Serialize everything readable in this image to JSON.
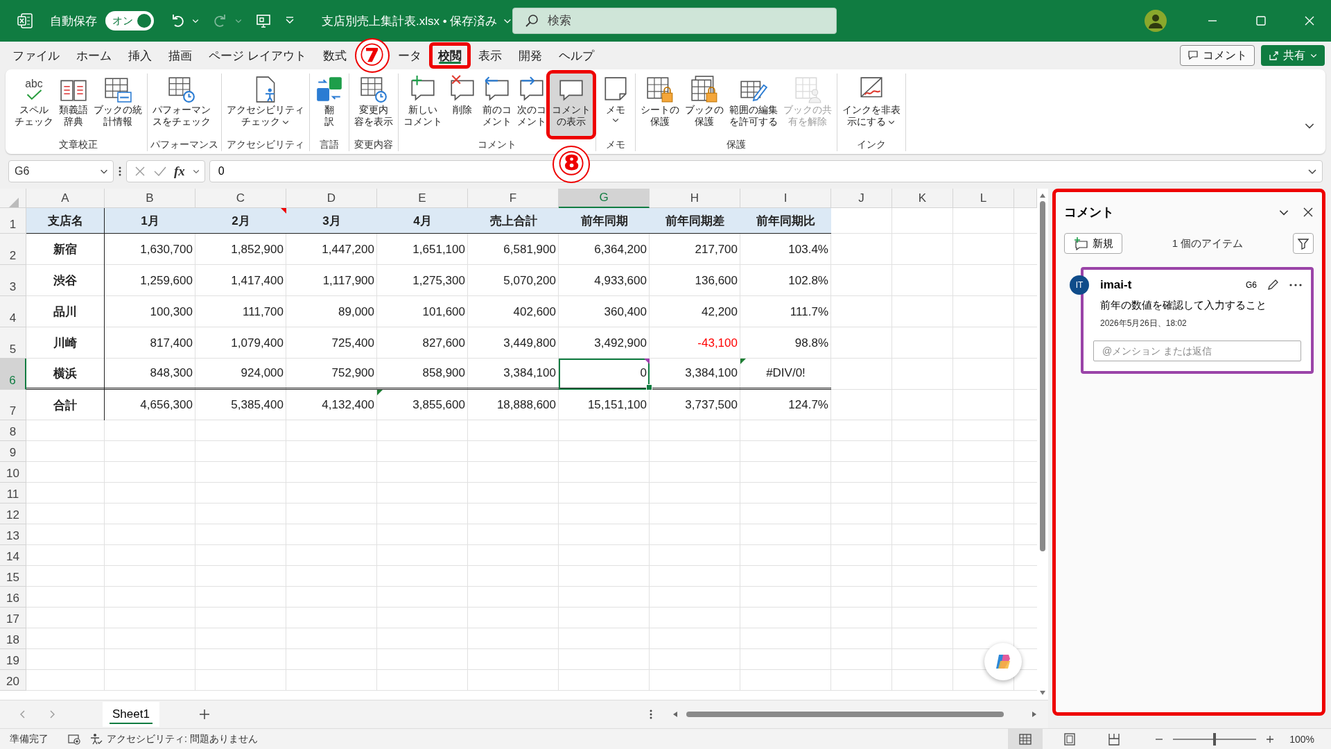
{
  "titlebar": {
    "autosave": {
      "label": "自動保存",
      "state_text": "オン",
      "on": true
    },
    "document_title": "支店別売上集計表.xlsx • 保存済み",
    "search_placeholder": "検索"
  },
  "menu_tabs": [
    {
      "label": "ファイル",
      "selected": false,
      "highlighted": false
    },
    {
      "label": "ホーム",
      "selected": false,
      "highlighted": false
    },
    {
      "label": "挿入",
      "selected": false,
      "highlighted": false
    },
    {
      "label": "描画",
      "selected": false,
      "highlighted": false
    },
    {
      "label": "ページ レイアウト",
      "selected": false,
      "highlighted": false
    },
    {
      "label": "数式",
      "selected": false,
      "highlighted": false
    },
    {
      "label": "ータ",
      "selected": false,
      "highlighted": false,
      "callout": "⑦"
    },
    {
      "label": "校閲",
      "selected": true,
      "highlighted": true
    },
    {
      "label": "表示",
      "selected": false,
      "highlighted": false
    },
    {
      "label": "開発",
      "selected": false,
      "highlighted": false
    },
    {
      "label": "ヘルプ",
      "selected": false,
      "highlighted": false
    }
  ],
  "header_buttons": {
    "comments": "コメント",
    "share": "共有"
  },
  "ribbon_groups": [
    {
      "label": "文章校正",
      "buttons": [
        {
          "lines": [
            "スペル",
            "チェック"
          ],
          "icon_text": "abc",
          "dropdown": false,
          "disabled": false,
          "on": false,
          "highlighted": false
        },
        {
          "lines": [
            "類義語",
            "辞典"
          ],
          "dropdown": false,
          "disabled": false,
          "on": false,
          "highlighted": false
        },
        {
          "lines": [
            "ブックの統",
            "計情報"
          ],
          "dropdown": false,
          "disabled": false,
          "on": false,
          "highlighted": false
        }
      ]
    },
    {
      "label": "パフォーマンス",
      "buttons": [
        {
          "lines": [
            "パフォーマン",
            "スをチェック"
          ],
          "dropdown": false,
          "disabled": false,
          "on": false,
          "highlighted": false
        }
      ]
    },
    {
      "label": "アクセシビリティ",
      "buttons": [
        {
          "lines": [
            "アクセシビリティ",
            "チェック"
          ],
          "dropdown": true,
          "disabled": false,
          "on": false,
          "highlighted": false
        }
      ]
    },
    {
      "label": "言語",
      "buttons": [
        {
          "lines": [
            "翻",
            "訳"
          ],
          "dropdown": false,
          "disabled": false,
          "on": false,
          "highlighted": false
        }
      ]
    },
    {
      "label": "変更内容",
      "buttons": [
        {
          "lines": [
            "変更内",
            "容を表示"
          ],
          "dropdown": false,
          "disabled": false,
          "on": false,
          "highlighted": false
        }
      ]
    },
    {
      "label": "コメント",
      "buttons": [
        {
          "lines": [
            "新しい",
            "コメント"
          ],
          "dropdown": false,
          "disabled": false,
          "on": false,
          "highlighted": false
        },
        {
          "lines": [
            "削除"
          ],
          "dropdown": false,
          "disabled": false,
          "on": false,
          "highlighted": false
        },
        {
          "lines": [
            "前のコ",
            "メント"
          ],
          "dropdown": false,
          "disabled": false,
          "on": false,
          "highlighted": false
        },
        {
          "lines": [
            "次のコ",
            "メント"
          ],
          "dropdown": false,
          "disabled": false,
          "on": false,
          "highlighted": false
        },
        {
          "lines": [
            "コメント",
            "の表示"
          ],
          "dropdown": false,
          "disabled": false,
          "on": true,
          "highlighted": true,
          "callout": "⑧"
        }
      ]
    },
    {
      "label": "メモ",
      "buttons": [
        {
          "lines": [
            "メモ"
          ],
          "dropdown": true,
          "disabled": false,
          "on": false,
          "highlighted": false
        }
      ]
    },
    {
      "label": "保護",
      "buttons": [
        {
          "lines": [
            "シートの",
            "保護"
          ],
          "dropdown": false,
          "disabled": false,
          "on": false,
          "highlighted": false
        },
        {
          "lines": [
            "ブックの",
            "保護"
          ],
          "dropdown": false,
          "disabled": false,
          "on": false,
          "highlighted": false
        },
        {
          "lines": [
            "範囲の編集",
            "を許可する"
          ],
          "dropdown": false,
          "disabled": false,
          "on": false,
          "highlighted": false
        },
        {
          "lines": [
            "ブックの共",
            "有を解除"
          ],
          "dropdown": false,
          "disabled": true,
          "on": false,
          "highlighted": false
        }
      ]
    },
    {
      "label": "インク",
      "buttons": [
        {
          "lines": [
            "インクを非表",
            "示にする"
          ],
          "dropdown": true,
          "disabled": false,
          "on": false,
          "highlighted": false
        }
      ]
    }
  ],
  "formula_bar": {
    "name_box": "G6",
    "function_label": "fx",
    "value": "0"
  },
  "sheet": {
    "columns": [
      {
        "label": "A",
        "selected": false
      },
      {
        "label": "B",
        "selected": false
      },
      {
        "label": "C",
        "selected": false
      },
      {
        "label": "D",
        "selected": false
      },
      {
        "label": "E",
        "selected": false
      },
      {
        "label": "F",
        "selected": false
      },
      {
        "label": "G",
        "selected": true
      },
      {
        "label": "H",
        "selected": false
      },
      {
        "label": "I",
        "selected": false
      },
      {
        "label": "J",
        "selected": false
      },
      {
        "label": "K",
        "selected": false
      },
      {
        "label": "L",
        "selected": false
      }
    ],
    "row_numbers": [
      {
        "label": "1",
        "selected": false
      },
      {
        "label": "2",
        "selected": false
      },
      {
        "label": "3",
        "selected": false
      },
      {
        "label": "4",
        "selected": false
      },
      {
        "label": "5",
        "selected": false
      },
      {
        "label": "6",
        "selected": true
      },
      {
        "label": "7",
        "selected": false
      },
      {
        "label": "8",
        "selected": false
      },
      {
        "label": "9",
        "selected": false
      },
      {
        "label": "10",
        "selected": false
      },
      {
        "label": "11",
        "selected": false
      },
      {
        "label": "12",
        "selected": false
      },
      {
        "label": "13",
        "selected": false
      },
      {
        "label": "14",
        "selected": false
      },
      {
        "label": "15",
        "selected": false
      },
      {
        "label": "16",
        "selected": false
      },
      {
        "label": "17",
        "selected": false
      },
      {
        "label": "18",
        "selected": false
      },
      {
        "label": "19",
        "selected": false
      },
      {
        "label": "20",
        "selected": false
      }
    ],
    "rows": [
      {
        "kind": "header",
        "cells": [
          "支店名",
          "1月",
          {
            "text": "2月",
            "kind": "note"
          },
          "3月",
          "4月",
          "売上合計",
          "前年同期",
          "前年同期差",
          "前年同期比"
        ]
      },
      {
        "kind": "data",
        "cells": [
          "新宿",
          "1,630,700",
          "1,852,900",
          "1,447,200",
          "1,651,100",
          "6,581,900",
          "6,364,200",
          "217,700",
          "103.4%"
        ]
      },
      {
        "kind": "data",
        "cells": [
          "渋谷",
          "1,259,600",
          "1,417,400",
          "1,117,900",
          "1,275,300",
          "5,070,200",
          "4,933,600",
          "136,600",
          "102.8%"
        ]
      },
      {
        "kind": "data",
        "cells": [
          "品川",
          "100,300",
          "111,700",
          "89,000",
          "101,600",
          "402,600",
          "360,400",
          "42,200",
          "111.7%"
        ]
      },
      {
        "kind": "data",
        "cells": [
          "川崎",
          "817,400",
          "1,079,400",
          "725,400",
          "827,600",
          "3,449,800",
          "3,492,900",
          {
            "text": "-43,100",
            "negative": true
          },
          "98.8%"
        ]
      },
      {
        "kind": "data",
        "cells": [
          "横浜",
          "848,300",
          "924,000",
          "752,900",
          "858,900",
          "3,384,100",
          {
            "text": "0",
            "kind": "comment",
            "selected": true
          },
          "3,384,100",
          {
            "text": "#DIV/0!",
            "kind": "error"
          }
        ]
      },
      {
        "kind": "total",
        "cells": [
          "合計",
          "4,656,300",
          "5,385,400",
          "4,132,400",
          {
            "text": "3,855,600",
            "kind": "error"
          },
          "18,888,600",
          "15,151,100",
          "3,737,500",
          "124.7%"
        ]
      }
    ]
  },
  "sheet_tabs": [
    {
      "label": "Sheet1",
      "selected": true
    }
  ],
  "comments_pane": {
    "title": "コメント",
    "highlighted": true,
    "new_button": "新規",
    "item_count": "1 個のアイテム",
    "comments": [
      {
        "initials": "IT",
        "author": "imai-t",
        "cell": "G6",
        "text": "前年の数値を確認して入力すること",
        "date": "2026年5月26日、18:02",
        "reply_placeholder": "@メンション または返信",
        "active": true
      }
    ]
  },
  "status_bar": {
    "ready": "準備完了",
    "accessibility": "アクセシビリティ: 問題ありません",
    "views": [
      {
        "kind": "normal",
        "selected": true
      },
      {
        "kind": "page-layout",
        "selected": false
      },
      {
        "kind": "page-break",
        "selected": false
      }
    ],
    "zoom": {
      "level": 0.5
    },
    "zoom_text": "100%"
  }
}
